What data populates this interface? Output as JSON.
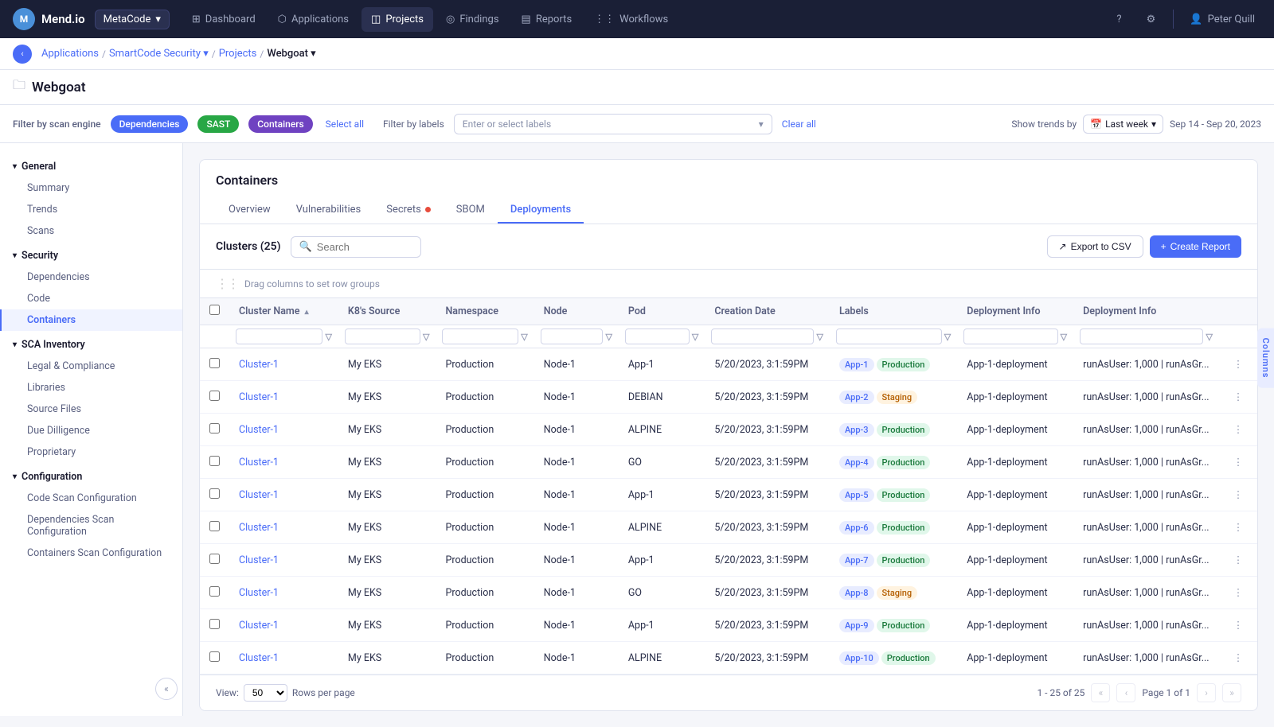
{
  "app": {
    "logo": "M",
    "brand": "Mend.io"
  },
  "nav": {
    "org_select": "MetaCode",
    "items": [
      {
        "label": "Dashboard",
        "icon": "⊞",
        "active": false
      },
      {
        "label": "Applications",
        "icon": "⬡",
        "active": false
      },
      {
        "label": "Projects",
        "icon": "◫",
        "active": true
      },
      {
        "label": "Findings",
        "icon": "◎",
        "active": false
      },
      {
        "label": "Reports",
        "icon": "▤",
        "active": false
      },
      {
        "label": "Workflows",
        "icon": "⋮⋮",
        "active": false
      }
    ],
    "user": "Peter Quill"
  },
  "breadcrumb": {
    "items": [
      "Applications",
      "SmartCode Security",
      "Projects",
      "Webgoat"
    ]
  },
  "page": {
    "title": "Webgoat",
    "folder_icon": "📁"
  },
  "filters": {
    "label": "Filter by scan engine",
    "chips": [
      "Dependencies",
      "SAST",
      "Containers"
    ],
    "select_all": "Select all",
    "labels_label": "Filter by labels",
    "labels_placeholder": "Enter or select labels",
    "clear_all": "Clear all",
    "trend_label": "Show trends by",
    "trend_value": "Last week",
    "trend_date": "Sep 14 - Sep 20, 2023"
  },
  "sidebar": {
    "sections": [
      {
        "title": "General",
        "items": [
          "Summary",
          "Trends",
          "Scans"
        ]
      },
      {
        "title": "Security",
        "items": [
          "Dependencies",
          "Code",
          "Containers"
        ]
      },
      {
        "title": "SCA Inventory",
        "items": [
          "Legal & Compliance",
          "Libraries",
          "Source Files",
          "Due Dilligence",
          "Proprietary"
        ]
      },
      {
        "title": "Configuration",
        "items": [
          "Code Scan Configuration",
          "Dependencies Scan Configuration",
          "Containers Scan Configuration"
        ]
      }
    ],
    "active_item": "Containers"
  },
  "panel": {
    "title": "Containers",
    "tabs": [
      "Overview",
      "Vulnerabilities",
      "Secrets",
      "SBOM",
      "Deployments"
    ],
    "active_tab": "Deployments",
    "secrets_has_dot": true
  },
  "clusters": {
    "count": 25,
    "search_placeholder": "Search",
    "export_label": "Export to CSV",
    "create_label": "Create Report",
    "drag_hint": "Drag columns to set row groups",
    "columns": [
      "Cluster Name",
      "K8's Source",
      "Namespace",
      "Node",
      "Pod",
      "Creation Date",
      "Labels",
      "Deployment Info",
      "Deployment Info"
    ],
    "rows": [
      {
        "cluster": "Cluster-1",
        "source": "My EKS",
        "namespace": "Production",
        "node": "Node-1",
        "pod": "App-1",
        "date": "5/20/2023, 3:1:59PM",
        "labels": [
          {
            "text": "App-1",
            "type": "default"
          },
          {
            "text": "Production",
            "type": "prod"
          }
        ],
        "deploy": "App-1-deployment",
        "deploy2": "runAsUser: 1,000 | runAsGr..."
      },
      {
        "cluster": "Cluster-1",
        "source": "My EKS",
        "namespace": "Production",
        "node": "Node-1",
        "pod": "DEBIAN",
        "date": "5/20/2023, 3:1:59PM",
        "labels": [
          {
            "text": "App-2",
            "type": "default"
          },
          {
            "text": "Staging",
            "type": "staging"
          }
        ],
        "deploy": "App-1-deployment",
        "deploy2": "runAsUser: 1,000 | runAsGr..."
      },
      {
        "cluster": "Cluster-1",
        "source": "My EKS",
        "namespace": "Production",
        "node": "Node-1",
        "pod": "ALPINE",
        "date": "5/20/2023, 3:1:59PM",
        "labels": [
          {
            "text": "App-3",
            "type": "default"
          },
          {
            "text": "Production",
            "type": "prod"
          }
        ],
        "deploy": "App-1-deployment",
        "deploy2": "runAsUser: 1,000 | runAsGr..."
      },
      {
        "cluster": "Cluster-1",
        "source": "My EKS",
        "namespace": "Production",
        "node": "Node-1",
        "pod": "GO",
        "date": "5/20/2023, 3:1:59PM",
        "labels": [
          {
            "text": "App-4",
            "type": "default"
          },
          {
            "text": "Production",
            "type": "prod"
          }
        ],
        "deploy": "App-1-deployment",
        "deploy2": "runAsUser: 1,000 | runAsGr..."
      },
      {
        "cluster": "Cluster-1",
        "source": "My EKS",
        "namespace": "Production",
        "node": "Node-1",
        "pod": "App-1",
        "date": "5/20/2023, 3:1:59PM",
        "labels": [
          {
            "text": "App-5",
            "type": "default"
          },
          {
            "text": "Production",
            "type": "prod"
          }
        ],
        "deploy": "App-1-deployment",
        "deploy2": "runAsUser: 1,000 | runAsGr..."
      },
      {
        "cluster": "Cluster-1",
        "source": "My EKS",
        "namespace": "Production",
        "node": "Node-1",
        "pod": "ALPINE",
        "date": "5/20/2023, 3:1:59PM",
        "labels": [
          {
            "text": "App-6",
            "type": "default"
          },
          {
            "text": "Production",
            "type": "prod"
          }
        ],
        "deploy": "App-1-deployment",
        "deploy2": "runAsUser: 1,000 | runAsGr..."
      },
      {
        "cluster": "Cluster-1",
        "source": "My EKS",
        "namespace": "Production",
        "node": "Node-1",
        "pod": "App-1",
        "date": "5/20/2023, 3:1:59PM",
        "labels": [
          {
            "text": "App-7",
            "type": "default"
          },
          {
            "text": "Production",
            "type": "prod"
          }
        ],
        "deploy": "App-1-deployment",
        "deploy2": "runAsUser: 1,000 | runAsGr..."
      },
      {
        "cluster": "Cluster-1",
        "source": "My EKS",
        "namespace": "Production",
        "node": "Node-1",
        "pod": "GO",
        "date": "5/20/2023, 3:1:59PM",
        "labels": [
          {
            "text": "App-8",
            "type": "default"
          },
          {
            "text": "Staging",
            "type": "staging"
          }
        ],
        "deploy": "App-1-deployment",
        "deploy2": "runAsUser: 1,000 | runAsGr..."
      },
      {
        "cluster": "Cluster-1",
        "source": "My EKS",
        "namespace": "Production",
        "node": "Node-1",
        "pod": "App-1",
        "date": "5/20/2023, 3:1:59PM",
        "labels": [
          {
            "text": "App-9",
            "type": "default"
          },
          {
            "text": "Production",
            "type": "prod"
          }
        ],
        "deploy": "App-1-deployment",
        "deploy2": "runAsUser: 1,000 | runAsGr..."
      },
      {
        "cluster": "Cluster-1",
        "source": "My EKS",
        "namespace": "Production",
        "node": "Node-1",
        "pod": "ALPINE",
        "date": "5/20/2023, 3:1:59PM",
        "labels": [
          {
            "text": "App-10",
            "type": "default"
          },
          {
            "text": "Production",
            "type": "prod"
          }
        ],
        "deploy": "App-1-deployment",
        "deploy2": "runAsUser: 1,000 | runAsGr..."
      }
    ],
    "pagination": {
      "view_label": "View:",
      "rows_per_page": "50",
      "rows_per_page_label": "Rows per page",
      "range": "1 - 25 of 25",
      "page_label": "Page 1 of 1"
    }
  },
  "right_tab": "Columns"
}
